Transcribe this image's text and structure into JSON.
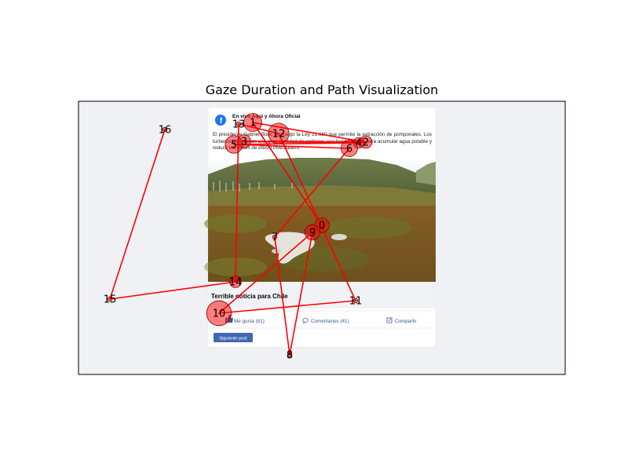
{
  "colors": {
    "path": "#ff0000",
    "fixation_fill": "#ff0000",
    "fixation_edge": "#8b0000",
    "plot_bg": "#f0f1f5",
    "facebook_blue": "#1877f2",
    "link_blue": "#385898",
    "button_bg": "#4267b2"
  },
  "post": {
    "page_name": "En vivo Aqui y Ahora Oficial",
    "body_text": "El presidente Gabriel Boric promulgó la Ley 21.660 que permite la extracción de pomponales. Los turberos almacenan una gran cantidad de carbono, una buena fuente para acumular agua potable y reducir los gases de efecto invernadero.",
    "caption": "Terrible noticia para Chile",
    "actions": {
      "like": "Me gusta (81)",
      "comments": "Comentarios (41)",
      "share": "Compartir"
    },
    "next_button": "Siguiente post",
    "icons": {
      "logo": "facebook-logo-icon",
      "like": "thumbs-up-icon",
      "comments": "comment-bubble-icon",
      "share": "share-icon"
    }
  },
  "chart_data": {
    "type": "scatter",
    "title": "Gaze Duration and Path Visualization",
    "xlabel": "",
    "ylabel": "",
    "grid": false,
    "legend": "none",
    "xlim": [
      0,
      620
    ],
    "ylim": [
      0,
      348
    ],
    "y_inverted": true,
    "points": [
      {
        "label": "0",
        "x": 310,
        "y": 158,
        "duration": 0.55
      },
      {
        "label": "1",
        "x": 222,
        "y": 27,
        "duration": 0.85
      },
      {
        "label": "2",
        "x": 366,
        "y": 52,
        "duration": 0.4
      },
      {
        "label": "3",
        "x": 211,
        "y": 51,
        "duration": 0.45
      },
      {
        "label": "4",
        "x": 357,
        "y": 53,
        "duration": 0.3
      },
      {
        "label": "5",
        "x": 198,
        "y": 55,
        "duration": 0.8
      },
      {
        "label": "6",
        "x": 345,
        "y": 60,
        "duration": 0.7
      },
      {
        "label": "7",
        "x": 250,
        "y": 173,
        "duration": 0.05
      },
      {
        "label": "8",
        "x": 269,
        "y": 323,
        "duration": 0.05
      },
      {
        "label": "9",
        "x": 298,
        "y": 167,
        "duration": 0.6
      },
      {
        "label": "10",
        "x": 179,
        "y": 270,
        "duration": 1.6
      },
      {
        "label": "11",
        "x": 353,
        "y": 254,
        "duration": 0.05
      },
      {
        "label": "12",
        "x": 255,
        "y": 41,
        "duration": 1.1
      },
      {
        "label": "13",
        "x": 204,
        "y": 29,
        "duration": 0.05
      },
      {
        "label": "14",
        "x": 200,
        "y": 230,
        "duration": 0.35
      },
      {
        "label": "15",
        "x": 40,
        "y": 252,
        "duration": 0.05
      },
      {
        "label": "16",
        "x": 110,
        "y": 36,
        "duration": 0.05
      }
    ]
  }
}
